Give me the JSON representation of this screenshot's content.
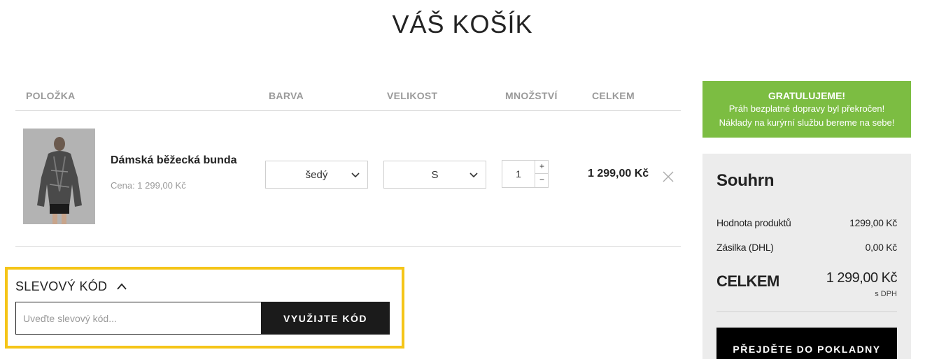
{
  "page": {
    "title": "VÁŠ KOŠÍK"
  },
  "cart_table": {
    "headers": {
      "item": "POLOŽKA",
      "color": "BARVA",
      "size": "VELIKOST",
      "quantity": "MNOŽSTVÍ",
      "total": "CELKEM"
    },
    "items": [
      {
        "name": "Dámská běžecká bunda",
        "price_label": "Cena: 1 299,00 Kč",
        "color": "šedý",
        "size": "S",
        "quantity": "1",
        "total": "1 299,00 Kč",
        "image_icon": "jacket-photo"
      }
    ],
    "qty_plus": "+",
    "qty_minus": "−"
  },
  "discount": {
    "title": "SLEVOVÝ KÓD",
    "placeholder": "Uveďte slevový kód...",
    "apply_label": "VYUŽIJTE KÓD"
  },
  "shipping_banner": {
    "title": "GRATULUJEME!",
    "line1": "Práh bezplatné dopravy byl překročen!",
    "line2": "Náklady na kurýrní službu bereme na sebe!"
  },
  "summary": {
    "title": "Souhrn",
    "products_label": "Hodnota produktů",
    "products_value": "1299,00 Kč",
    "shipping_label": "Zásilka (DHL)",
    "shipping_value": "0,00 Kč",
    "total_label": "CELKEM",
    "total_value": "1 299,00 Kč",
    "vat_note": "s DPH",
    "checkout_label": "PŘEJDĚTE DO POKLADNY"
  },
  "colors": {
    "accent_green": "#7cbd42",
    "highlight_yellow": "#f5c518",
    "button_black": "#1b1b1b"
  }
}
